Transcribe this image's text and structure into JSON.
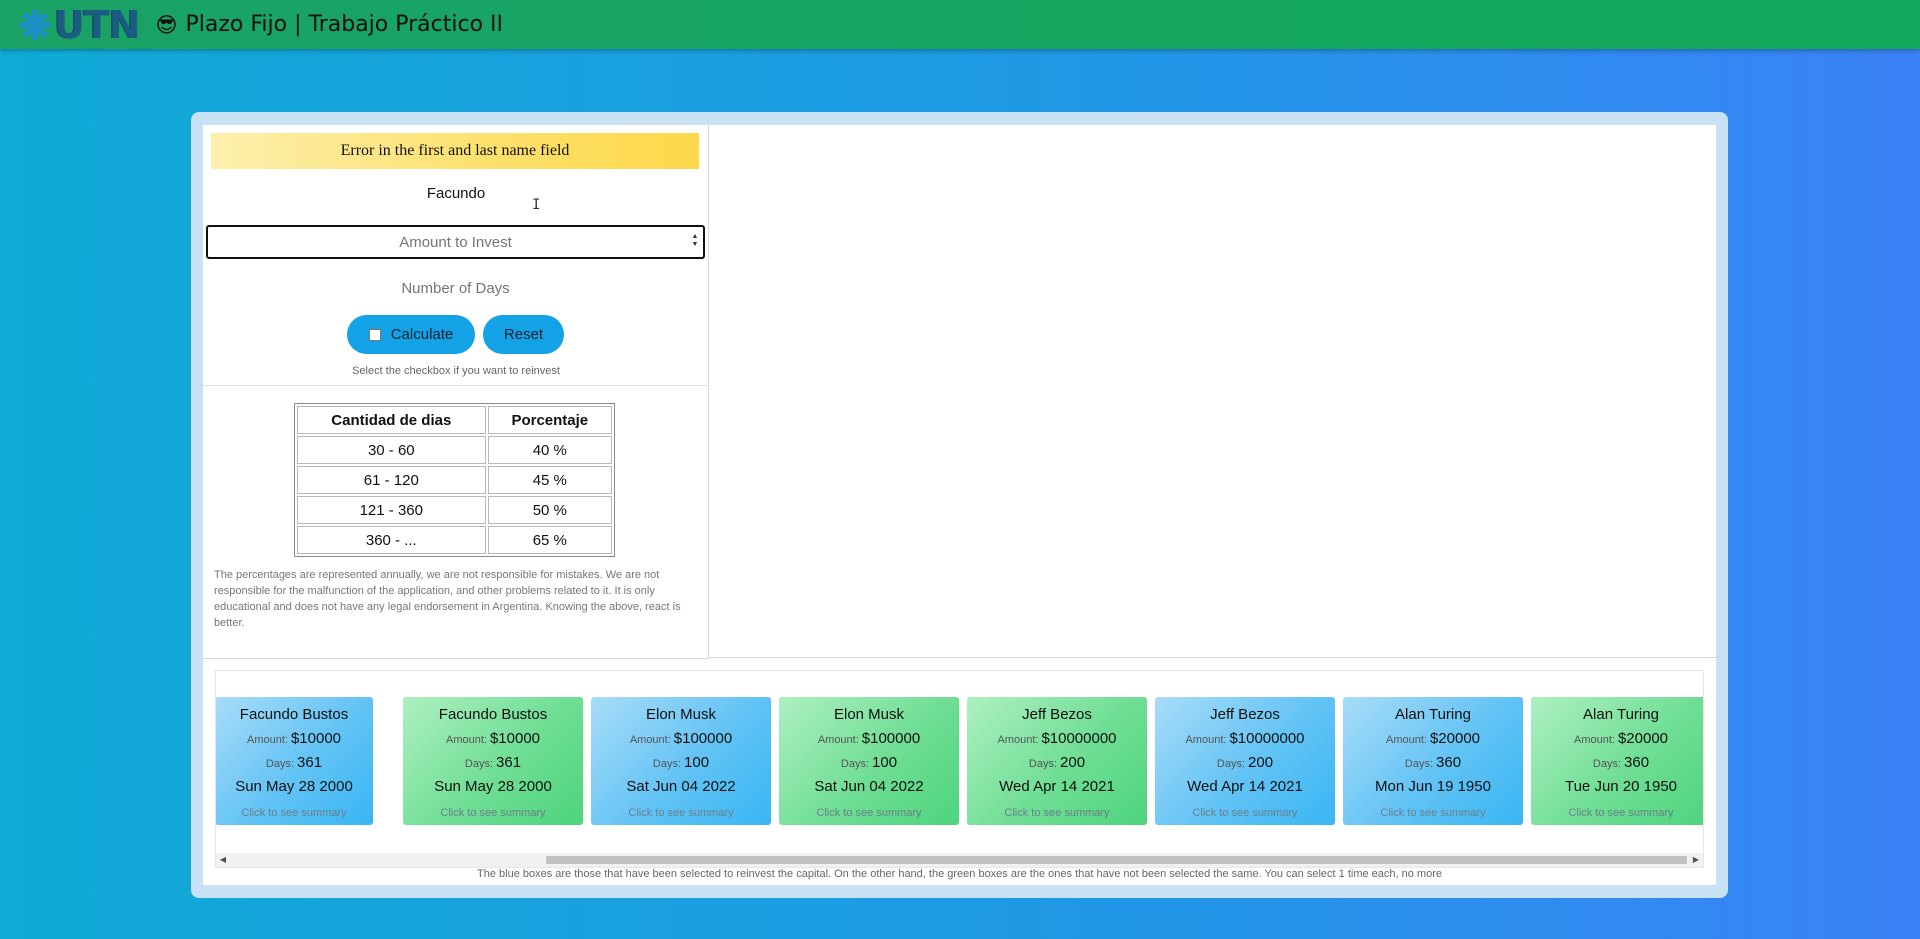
{
  "header": {
    "logo_text": "UTN",
    "title": "Plazo Fijo | Trabajo Práctico II",
    "emoji": "😎"
  },
  "form": {
    "error_message": "Error in the first and last name field",
    "name_value": "Facundo",
    "amount_placeholder": "Amount to Invest",
    "days_placeholder": "Number of Days",
    "calculate_label": "Calculate",
    "reset_label": "Reset",
    "reinvest_checked": false,
    "reinvest_hint": "Select the checkbox if you want to reinvest"
  },
  "rates_table": {
    "headers": [
      "Cantidad de dias",
      "Porcentaje"
    ],
    "rows": [
      [
        "30 - 60",
        "40 %"
      ],
      [
        "61 - 120",
        "45 %"
      ],
      [
        "121 - 360",
        "50 %"
      ],
      [
        "360 - ...",
        "65 %"
      ]
    ]
  },
  "disclaimer": "The percentages are represented annually, we are not responsible for mistakes. We are not responsible for the malfunction of the application, and other problems related to it. It is only educational and does not have any legal endorsement in Argentina. Knowing the above, react is better.",
  "investments": {
    "amount_label": "Amount:",
    "days_label": "Days:",
    "summary_hint": "Click to see summary",
    "items": [
      {
        "name": "Facundo Bustos",
        "amount": "$10000",
        "days": "361",
        "date": "Sun May 28 2000",
        "color": "blue"
      },
      {
        "name": "Facundo Bustos",
        "amount": "$10000",
        "days": "361",
        "date": "Sun May 28 2000",
        "color": "green"
      },
      {
        "name": "Elon Musk",
        "amount": "$100000",
        "days": "100",
        "date": "Sat Jun 04 2022",
        "color": "blue"
      },
      {
        "name": "Elon Musk",
        "amount": "$100000",
        "days": "100",
        "date": "Sat Jun 04 2022",
        "color": "green"
      },
      {
        "name": "Jeff Bezos",
        "amount": "$10000000",
        "days": "200",
        "date": "Wed Apr 14 2021",
        "color": "green"
      },
      {
        "name": "Jeff Bezos",
        "amount": "$10000000",
        "days": "200",
        "date": "Wed Apr 14 2021",
        "color": "blue"
      },
      {
        "name": "Alan Turing",
        "amount": "$20000",
        "days": "360",
        "date": "Mon Jun 19 1950",
        "color": "blue"
      },
      {
        "name": "Alan Turing",
        "amount": "$20000",
        "days": "360",
        "date": "Tue Jun 20 1950",
        "color": "green"
      }
    ],
    "scroll_position": 0.22
  },
  "footnote": "The blue boxes are those that have been selected to reinvest the capital. On the other hand, the green boxes are the ones that have not been selected the same. You can select 1 time each, no more",
  "colors": {
    "header": "#12a95c",
    "button": "#14a2e6",
    "card_blue": "#5ec2f5",
    "card_green": "#6fde95",
    "alert": "#fde06a"
  }
}
